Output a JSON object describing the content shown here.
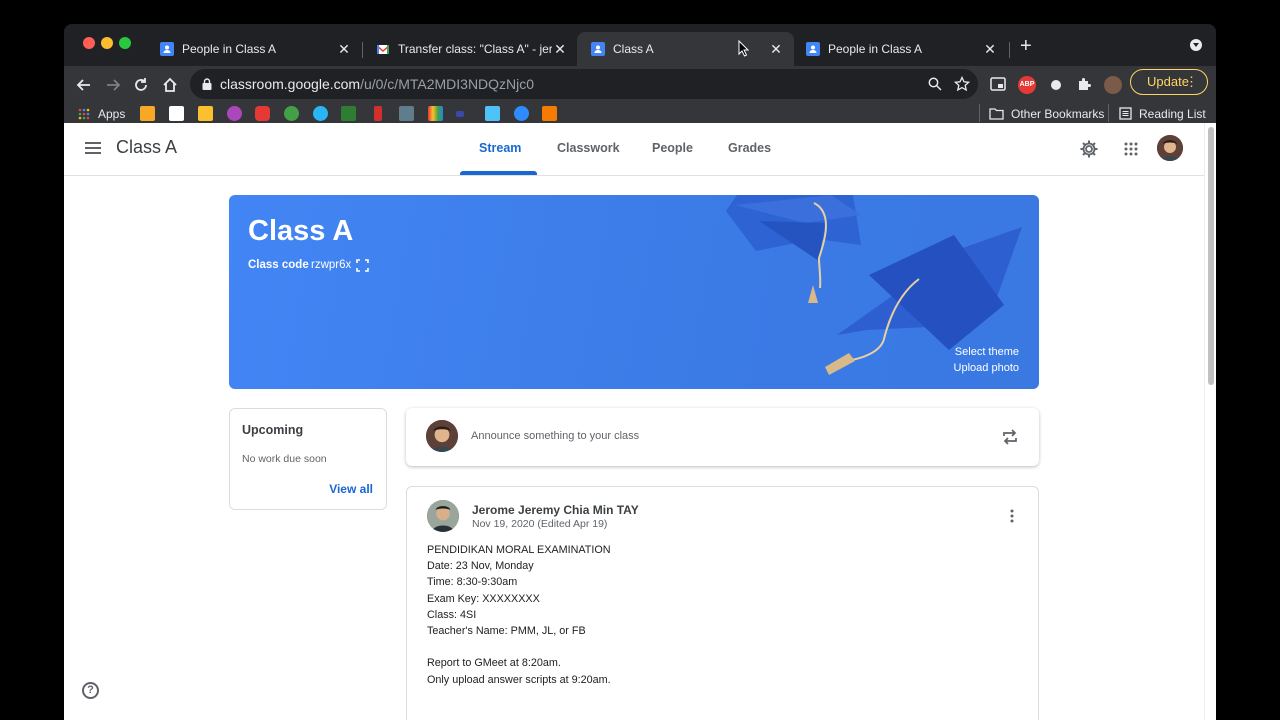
{
  "browser": {
    "tabs": [
      {
        "title": "People in Class A",
        "favicon": "classroom-icon",
        "active": false
      },
      {
        "title": "Transfer class: \"Class A\" - jero",
        "favicon": "gmail-icon",
        "active": false
      },
      {
        "title": "Class A",
        "favicon": "classroom-icon",
        "active": true
      },
      {
        "title": "People in Class A",
        "favicon": "classroom-icon",
        "active": false
      }
    ],
    "close_glyph": "✕",
    "new_tab_glyph": "+",
    "url_host": "classroom.google.com",
    "url_path": "/u/0/c/MTA2MDI3NDQzNjc0",
    "update_label": "Update",
    "bookmarks": {
      "apps_label": "Apps",
      "other_label": "Other Bookmarks",
      "reading_label": "Reading List"
    }
  },
  "classroom": {
    "class_name": "Class A",
    "nav_tabs": [
      "Stream",
      "Classwork",
      "People",
      "Grades"
    ],
    "active_tab": "Stream",
    "banner": {
      "title": "Class A",
      "code_label": "Class code",
      "code_value": "rzwpr6x",
      "select_theme": "Select theme",
      "upload_photo": "Upload photo"
    },
    "upcoming": {
      "heading": "Upcoming",
      "status": "No work due soon",
      "view_all": "View all"
    },
    "announce_placeholder": "Announce something to your class",
    "post": {
      "author": "Jerome Jeremy Chia Min TAY",
      "date": "Nov 19, 2020 (Edited Apr 19)",
      "lines": [
        "PENDIDIKAN MORAL EXAMINATION",
        "Date: 23 Nov, Monday",
        "Time: 8:30-9:30am",
        "Exam Key: XXXXXXXX",
        "Class: 4SI",
        "Teacher's Name: PMM, JL, or FB",
        "",
        "Report to GMeet at 8:20am.",
        "Only upload answer scripts at 9:20am."
      ]
    },
    "help_glyph": "?"
  },
  "colors": {
    "accent": "#1967d2",
    "banner": "#4285f4",
    "browser_dark": "#202124",
    "toolbar": "#35363a",
    "update": "#fdd663"
  }
}
